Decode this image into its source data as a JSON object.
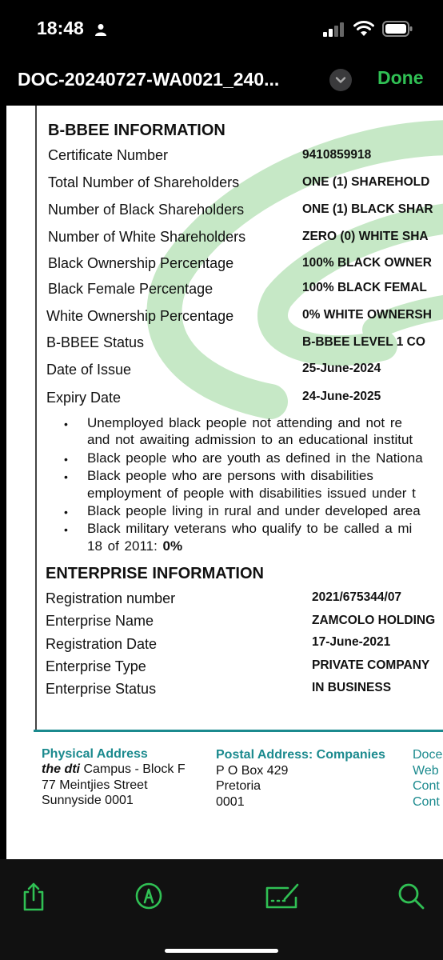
{
  "status_bar": {
    "time": "18:48",
    "icons": [
      "person-icon",
      "signal-icon",
      "wifi-icon",
      "battery-icon"
    ]
  },
  "nav": {
    "title": "DOC-20240727-WA0021_240...",
    "done_label": "Done",
    "accent_color": "#30c054"
  },
  "document": {
    "bbbee": {
      "heading": "B-BBEE INFORMATION",
      "rows": [
        {
          "label": "Certificate Number",
          "value": "9410859918"
        },
        {
          "label": "Total Number of Shareholders",
          "value": "ONE (1) SHAREHOLD"
        },
        {
          "label": "Number of Black Shareholders",
          "value": "ONE (1) BLACK SHAR"
        },
        {
          "label": "Number of White Shareholders",
          "value": "ZERO (0) WHITE SHA"
        },
        {
          "label": "Black Ownership Percentage",
          "value": "100% BLACK OWNER"
        },
        {
          "label": "Black Female Percentage",
          "value": "100% BLACK FEMAL"
        },
        {
          "label": "White Ownership Percentage",
          "value": "0% WHITE OWNERSH"
        },
        {
          "label": "B-BBEE Status",
          "value": "B-BBEE LEVEL 1 CO"
        },
        {
          "label": "Date of Issue",
          "value": "25-June-2024"
        },
        {
          "label": "Expiry Date",
          "value": "24-June-2025"
        }
      ]
    },
    "bullets": {
      "bullet_char": "•",
      "lines": [
        "Unemployed black  people not  attending  and not  re",
        "and not awaiting admission to an educational institut",
        "Black people who are youth as defined in the Nationa",
        "Black   people   who   are   persons   with  disabilities",
        "employment of people with disabilities issued under t",
        "Black people living in rural and under developed area",
        "Black military veterans  who qualify to be called a mi",
        "18 of 2011: ",
        "0%"
      ]
    },
    "enterprise": {
      "heading": "ENTERPRISE INFORMATION",
      "rows": [
        {
          "label": "Registration number",
          "value": "2021/675344/07"
        },
        {
          "label": "Enterprise Name",
          "value": "ZAMCOLO HOLDING"
        },
        {
          "label": "Registration Date",
          "value": "17-June-2021"
        },
        {
          "label": "Enterprise Type",
          "value": "PRIVATE COMPANY"
        },
        {
          "label": "Enterprise Status",
          "value": "IN BUSINESS"
        }
      ]
    },
    "footer": {
      "physical": {
        "heading": "Physical Address",
        "brand": "the dti",
        "line1_rest": " Campus - Block F",
        "line2": "77 Meintjies Street",
        "line3": "Sunnyside 0001"
      },
      "postal": {
        "heading": "Postal Address: Companies",
        "line1": "P O Box 429",
        "line2": "Pretoria",
        "line3": "0001"
      },
      "links": [
        "Doce",
        "Web",
        "Cont",
        "Cont"
      ],
      "accent_color": "#1b8a8e"
    }
  },
  "toolbar": {
    "icons": [
      "share-icon",
      "markup-icon",
      "signature-icon",
      "search-icon"
    ],
    "icon_color": "#30c054"
  }
}
